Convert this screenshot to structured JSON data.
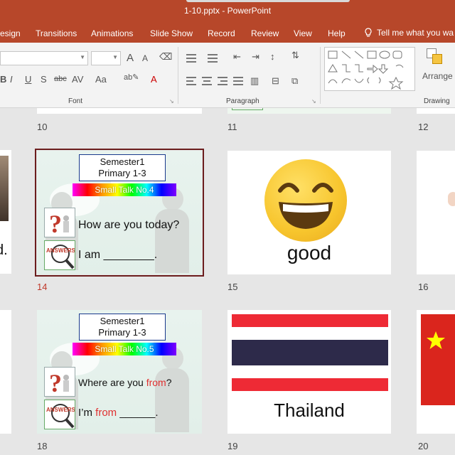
{
  "window": {
    "title": "1-10.pptx  -  PowerPoint"
  },
  "tabs": [
    {
      "label": "esign"
    },
    {
      "label": "Transitions"
    },
    {
      "label": "Animations"
    },
    {
      "label": "Slide Show"
    },
    {
      "label": "Record"
    },
    {
      "label": "Review"
    },
    {
      "label": "View"
    },
    {
      "label": "Help"
    }
  ],
  "tell_me": {
    "label": "Tell me what you wa"
  },
  "ribbon": {
    "font_group": "Font",
    "paragraph_group": "Paragraph",
    "drawing_group": "Drawing",
    "arrange_label": "Arrange",
    "bold_glyphs": {
      "b": "B",
      "i": "I",
      "u": "U",
      "s": "S",
      "abc": "abc",
      "av": "AV",
      "aa": "Aa"
    },
    "font_grow": "A",
    "font_shrink": "A"
  },
  "slides": {
    "row1_numbers": [
      "10",
      "11",
      "12"
    ],
    "row2": {
      "left_partial_text": "d.",
      "slide14": {
        "number": "14",
        "semester_line1": "Semester1",
        "semester_line2": "Primary 1-3",
        "banner": "Small Talk No.4",
        "question": "How are you today?",
        "answer": "I am ________."
      },
      "slide15": {
        "number": "15",
        "caption": "good"
      },
      "slide16": {
        "number": "16"
      }
    },
    "row3": {
      "slide18": {
        "number": "18",
        "semester_line1": "Semester1",
        "semester_line2": "Primary 1-3",
        "banner": "Small Talk No.5",
        "question_pre": "Where are you ",
        "question_red": "from",
        "question_post": "?",
        "answer_pre": "I’m ",
        "answer_red": "from",
        "answer_post": " ______."
      },
      "slide19": {
        "number": "19",
        "caption": "Thailand"
      },
      "slide20": {
        "number": "20"
      }
    }
  },
  "colors": {
    "accent": "#b7472a",
    "selected_border": "#6b1d1d",
    "thai_red": "#ee2a35",
    "thai_blue": "#2d2a4a",
    "vietnam_red": "#da251d",
    "vietnam_star": "#ffff00"
  },
  "icons": {
    "answer_icon_text": "ANSWERS"
  }
}
